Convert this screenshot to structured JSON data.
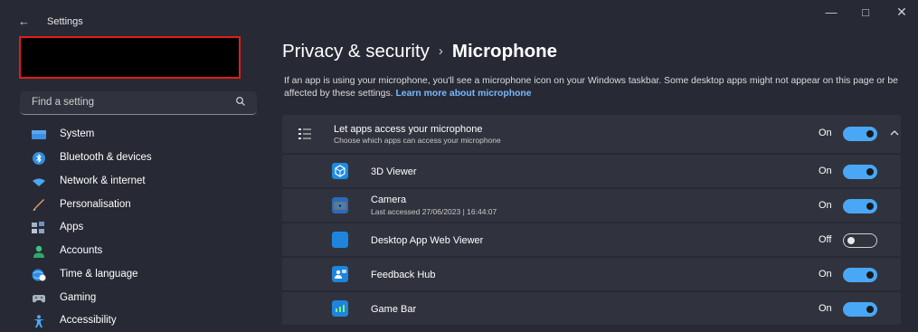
{
  "window": {
    "back_icon": "←",
    "title": "Settings",
    "minimize_icon": "—",
    "maximize_icon": "□",
    "close_icon": "✕"
  },
  "sidebar": {
    "search_placeholder": "Find a setting",
    "items": [
      {
        "label": "System",
        "icon": "system-icon"
      },
      {
        "label": "Bluetooth & devices",
        "icon": "bluetooth-icon"
      },
      {
        "label": "Network & internet",
        "icon": "network-icon"
      },
      {
        "label": "Personalisation",
        "icon": "personalisation-icon"
      },
      {
        "label": "Apps",
        "icon": "apps-icon"
      },
      {
        "label": "Accounts",
        "icon": "accounts-icon"
      },
      {
        "label": "Time & language",
        "icon": "time-language-icon"
      },
      {
        "label": "Gaming",
        "icon": "gaming-icon"
      },
      {
        "label": "Accessibility",
        "icon": "accessibility-icon"
      }
    ]
  },
  "main": {
    "breadcrumb_parent": "Privacy & security",
    "breadcrumb_sep": "›",
    "breadcrumb_current": "Microphone",
    "description": "If an app is using your microphone, you'll see a microphone icon on your Windows taskbar. Some desktop apps might not appear on this page or be affected by these settings.",
    "learn_more": "Learn more about microphone",
    "master": {
      "title": "Let apps access your microphone",
      "subtitle": "Choose which apps can access your microphone",
      "state": "On"
    },
    "apps": [
      {
        "name": "3D Viewer",
        "sub": "",
        "state": "On",
        "icon": "3d-viewer-icon"
      },
      {
        "name": "Camera",
        "sub": "Last accessed 27/06/2023  |  16:44:07",
        "state": "On",
        "icon": "camera-icon"
      },
      {
        "name": "Desktop App Web Viewer",
        "sub": "",
        "state": "Off",
        "icon": "desktop-app-web-viewer-icon"
      },
      {
        "name": "Feedback Hub",
        "sub": "",
        "state": "On",
        "icon": "feedback-hub-icon"
      },
      {
        "name": "Game Bar",
        "sub": "",
        "state": "On",
        "icon": "game-bar-icon"
      }
    ]
  },
  "colors": {
    "background": "#272a34",
    "card": "#30333d",
    "accent": "#4aa7f5",
    "link": "#78b8ff",
    "redaction_border": "#e41b1b"
  }
}
